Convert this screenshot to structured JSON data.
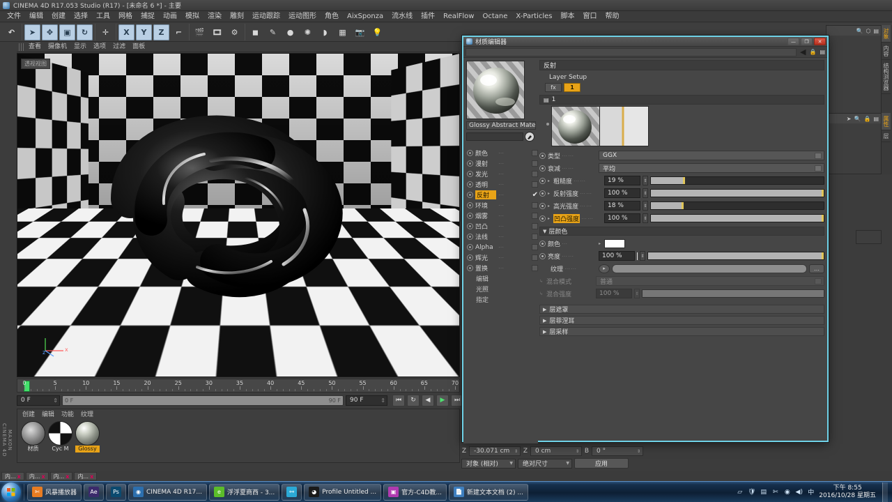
{
  "app": {
    "title": "CINEMA 4D R17.053 Studio (R17) - [未命名 6 *] - 主要",
    "logo_icon": "c4d-logo-icon"
  },
  "menubar": {
    "items": [
      "文件",
      "编辑",
      "创建",
      "选择",
      "工具",
      "网格",
      "捕捉",
      "动画",
      "模拟",
      "渲染",
      "雕刻",
      "运动跟踪",
      "运动图形",
      "角色",
      "AixSponza",
      "流水线",
      "插件",
      "RealFlow",
      "Octane",
      "X-Particles",
      "脚本",
      "窗口",
      "帮助"
    ]
  },
  "toolbar": {
    "groups": [
      {
        "buttons": [
          {
            "name": "undo-button",
            "glyph": "↶"
          }
        ]
      },
      {
        "buttons": [
          {
            "name": "live-selection-tool",
            "glyph": "➤"
          },
          {
            "name": "move-tool",
            "glyph": "✥"
          },
          {
            "name": "scale-tool",
            "glyph": "▣"
          },
          {
            "name": "rotate-tool",
            "glyph": "↻"
          }
        ]
      },
      {
        "buttons": [
          {
            "name": "move-axis-tool",
            "glyph": "✛"
          }
        ]
      },
      {
        "buttons": [
          {
            "name": "lock-x-axis-button",
            "glyph": "X"
          },
          {
            "name": "lock-y-axis-button",
            "glyph": "Y"
          },
          {
            "name": "lock-z-axis-button",
            "glyph": "Z"
          },
          {
            "name": "world-object-coordinate-button",
            "glyph": "⌐"
          }
        ]
      },
      {
        "buttons": [
          {
            "name": "render-view-button",
            "glyph": "🎬"
          },
          {
            "name": "render-region-button",
            "glyph": "🎞"
          },
          {
            "name": "render-settings-button",
            "glyph": "⚙"
          }
        ]
      },
      {
        "buttons": [
          {
            "name": "add-cube-object-button",
            "glyph": "◼"
          },
          {
            "name": "add-spline-button",
            "glyph": "✎"
          },
          {
            "name": "add-nurbs-button",
            "glyph": "●"
          },
          {
            "name": "add-array-button",
            "glyph": "✺"
          },
          {
            "name": "add-scene-object-button",
            "glyph": "◗"
          },
          {
            "name": "add-deformer-button",
            "glyph": "▦"
          },
          {
            "name": "add-camera-button",
            "glyph": "📷"
          },
          {
            "name": "add-light-button",
            "glyph": "💡"
          }
        ]
      }
    ]
  },
  "viewport": {
    "menu": [
      "查看",
      "摄像机",
      "显示",
      "选项",
      "过滤",
      "面板"
    ],
    "tag": "透视视图",
    "axis": {
      "x": "x",
      "y": "y",
      "z": "z"
    }
  },
  "timeline": {
    "ticks": [
      0,
      5,
      10,
      15,
      20,
      25,
      30,
      35,
      40,
      45,
      50,
      55,
      60,
      65,
      70
    ],
    "current_frame": "0 F",
    "range_start": "0 F",
    "range_end": "90 F",
    "end_frame": "90 F",
    "transport": [
      {
        "name": "go-to-start-button",
        "glyph": "⏮"
      },
      {
        "name": "loop-button",
        "glyph": "↻"
      },
      {
        "name": "play-backward-button",
        "glyph": "◀"
      },
      {
        "name": "play-forward-button",
        "glyph": "▶"
      },
      {
        "name": "go-to-end-button",
        "glyph": "⏭"
      }
    ]
  },
  "material_manager": {
    "menu": [
      "创建",
      "编辑",
      "功能",
      "纹理"
    ],
    "brand": "MAXON CINEMA 4D",
    "materials": [
      {
        "label": "材质",
        "selected": false,
        "kind": "sphere-gray"
      },
      {
        "label": "Cyc M",
        "selected": false,
        "kind": "checker"
      },
      {
        "label": "Glossy",
        "selected": true,
        "kind": "sphere-chrome"
      }
    ]
  },
  "bottom_tabs": [
    {
      "label": "内...",
      "close": "x"
    },
    {
      "label": "内...",
      "close": "x"
    },
    {
      "label": "内...",
      "close": "x"
    },
    {
      "label": "内...",
      "close": "x"
    }
  ],
  "coordinates": {
    "rows": [
      {
        "axis": "Z",
        "value": "-30.071 cm"
      },
      {
        "axis": "Z",
        "value": "0 cm"
      },
      {
        "axis": "B",
        "value": "0 °"
      }
    ],
    "mode": "对象 (相对)",
    "size_mode": "绝对尺寸",
    "apply_label": "应用"
  },
  "right_docks": {
    "object_tabs": [
      {
        "label": "对象",
        "selected": true
      },
      {
        "label": "内容",
        "selected": false
      },
      {
        "label": "结构浏览器",
        "selected": false
      }
    ],
    "attr_tabs": [
      {
        "label": "属性",
        "selected": true
      },
      {
        "label": "层",
        "selected": false
      }
    ]
  },
  "material_editor": {
    "window_title": "材质编辑器",
    "window_icon": "c4d-logo-icon",
    "window_buttons": [
      {
        "name": "minimize-button",
        "glyph": "—"
      },
      {
        "name": "maximize-button",
        "glyph": "❐"
      },
      {
        "name": "close-button",
        "glyph": "✕"
      }
    ],
    "subbar": {
      "collapse_icon": "triangle-left-icon",
      "lock_icon": "lock-icon",
      "menu_icon": "panel-menu-icon"
    },
    "material_name": "Glossy Abstract Mater",
    "preview_icon": "material-preview-sphere",
    "eyedropper_icon": "eyedropper-icon",
    "channels": [
      {
        "label": "颜色",
        "checked": false,
        "selected": false
      },
      {
        "label": "漫射",
        "checked": false,
        "selected": false
      },
      {
        "label": "发光",
        "checked": false,
        "selected": false
      },
      {
        "label": "透明",
        "checked": false,
        "selected": false
      },
      {
        "label": "反射",
        "checked": true,
        "selected": true
      },
      {
        "label": "环境",
        "checked": false,
        "selected": false
      },
      {
        "label": "烟雾",
        "checked": false,
        "selected": false
      },
      {
        "label": "凹凸",
        "checked": false,
        "selected": false
      },
      {
        "label": "法线",
        "checked": false,
        "selected": false
      },
      {
        "label": "Alpha",
        "checked": false,
        "selected": false
      },
      {
        "label": "辉光",
        "checked": false,
        "selected": false
      },
      {
        "label": "置换",
        "checked": false,
        "selected": false
      }
    ],
    "channels_plain": [
      "编辑",
      "光照",
      "指定"
    ],
    "section_title": "反射",
    "layer_setup_label": "Layer Setup",
    "layer_buttons": [
      {
        "name": "add-fresnel-button",
        "label": "fx",
        "active": false
      },
      {
        "name": "layer-1-button",
        "label": "1",
        "active": true
      }
    ],
    "layer_header": "1",
    "layer_header_icon": "layer-icon",
    "params": [
      {
        "name": "type",
        "label": "类型",
        "value": "GGX",
        "widget": "combo"
      },
      {
        "name": "attenuation",
        "label": "衰减",
        "value": "平均",
        "widget": "combo"
      },
      {
        "name": "roughness",
        "label": "粗糙度",
        "value": "19 %",
        "widget": "slider",
        "pct": 19
      },
      {
        "name": "reflection-strength",
        "label": "反射强度",
        "value": "100 %",
        "widget": "slider",
        "pct": 100
      },
      {
        "name": "specular-strength",
        "label": "高光强度",
        "value": "18 %",
        "widget": "slider",
        "pct": 18
      },
      {
        "name": "bump-strength",
        "label": "凹凸强度",
        "value": "100 %",
        "widget": "slider",
        "pct": 100,
        "highlight": true
      }
    ],
    "layer_color": {
      "title": "层颜色",
      "color_label": "颜色",
      "color_value": "#ffffff",
      "brightness_label": "亮度",
      "brightness_value": "100 %",
      "brightness_pct": 100,
      "texture_label": "纹理",
      "blend_mode_label": "混合模式",
      "blend_mode_value": "普通",
      "blend_strength_label": "混合强度",
      "blend_strength_value": "100 %",
      "blend_strength_pct": 100
    },
    "collapsed_sections": [
      "层遮罩",
      "层菲涅耳",
      "层采样"
    ]
  },
  "taskbar": {
    "start_icon": "windows-start-orb",
    "items": [
      {
        "label": "风暴播放器",
        "icon_name": "storm-player-icon",
        "icon_color": "#e87c22",
        "glyph": "✄"
      },
      {
        "label": "",
        "icon_name": "after-effects-icon",
        "icon_color": "#3b2a6b",
        "glyph": "Ae"
      },
      {
        "label": "",
        "icon_name": "photoshop-icon",
        "icon_color": "#0b4a6f",
        "glyph": "Ps"
      },
      {
        "label": "CINEMA 4D R17...",
        "icon_name": "cinema4d-icon",
        "icon_color": "#2c6fae",
        "glyph": "◉"
      },
      {
        "label": "浮浮夏商西 - 3...",
        "icon_name": "browser-icon",
        "icon_color": "#5bbd2a",
        "glyph": "e"
      },
      {
        "label": "",
        "icon_name": "network-icon",
        "icon_color": "#2ba9d6",
        "glyph": "⚯"
      },
      {
        "label": "Profile Untitled ...",
        "icon_name": "profile-icon",
        "icon_color": "#1a1a1a",
        "glyph": "◕"
      },
      {
        "label": "官方-C4D教...",
        "icon_name": "video-icon",
        "icon_color": "#b03ab0",
        "glyph": "▣"
      },
      {
        "label": "新建文本文档 (2) ...",
        "icon_name": "notepad-icon",
        "icon_color": "#3f7fbf",
        "glyph": "📄"
      }
    ],
    "tray_icons": [
      {
        "name": "hidden-icons-icon",
        "glyph": "▱"
      },
      {
        "name": "security-shield-icon",
        "glyph": "🛡"
      },
      {
        "name": "monitor-icon",
        "glyph": "▤"
      },
      {
        "name": "scissors-icon",
        "glyph": "✄"
      },
      {
        "name": "network-tray-icon",
        "glyph": "◉"
      },
      {
        "name": "volume-icon",
        "glyph": "◀)"
      },
      {
        "name": "input-method-icon",
        "glyph": "中"
      }
    ],
    "clock_time": "下午 8:55",
    "clock_date": "2016/10/28 星期五"
  }
}
